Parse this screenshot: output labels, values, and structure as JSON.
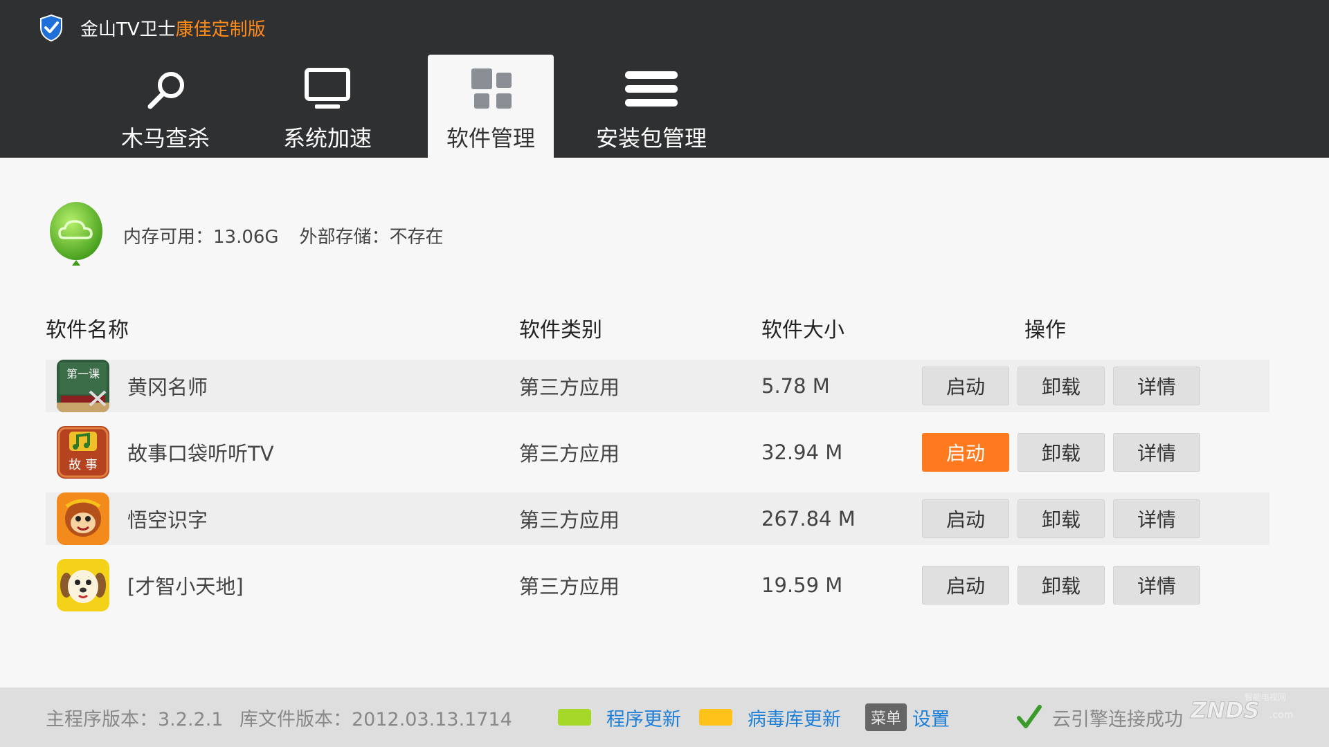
{
  "app": {
    "title_main": "金山TV卫士",
    "title_accent": "康佳定制版",
    "accent_color": "#ff8c1a"
  },
  "nav": {
    "tabs": [
      {
        "label": "木马查杀",
        "icon": "magnifier-icon"
      },
      {
        "label": "系统加速",
        "icon": "monitor-icon"
      },
      {
        "label": "软件管理",
        "icon": "grid-icon",
        "active": true
      },
      {
        "label": "安装包管理",
        "icon": "menu-lines-icon"
      }
    ]
  },
  "memory": {
    "available": "内存可用：13.06G",
    "external": "外部存储：不存在"
  },
  "table": {
    "headers": {
      "name": "软件名称",
      "category": "软件类别",
      "size": "软件大小",
      "action": "操作"
    },
    "rows": [
      {
        "name": "黄冈名师",
        "category": "第三方应用",
        "size": "5.78 M",
        "icon": "chalkboard-app-icon",
        "icon_text": "第一课"
      },
      {
        "name": "故事口袋听听TV",
        "category": "第三方应用",
        "size": "32.94 M",
        "icon": "story-app-icon",
        "icon_text": "故 事"
      },
      {
        "name": "悟空识字",
        "category": "第三方应用",
        "size": "267.84 M",
        "icon": "monkey-app-icon"
      },
      {
        "name": "[才智小天地]",
        "category": "第三方应用",
        "size": "19.59 M",
        "icon": "dog-app-icon"
      }
    ],
    "buttons": {
      "launch": "启动",
      "uninstall": "卸载",
      "details": "详情"
    },
    "focused_button_color": "#ff7a1e"
  },
  "footer": {
    "program_version": "主程序版本：3.2.2.1",
    "library_version": "库文件版本：2012.03.13.1714",
    "program_update": "程序更新",
    "program_update_color": "#a6d82a",
    "virus_update": "病毒库更新",
    "virus_update_color": "#ffc21a",
    "menu_key": "菜单",
    "settings": "设置",
    "cloud_status": "云引擎连接成功",
    "watermark_text": "ZNDS",
    "watermark_sub": "智能电视网",
    "watermark_domain": ".com"
  }
}
